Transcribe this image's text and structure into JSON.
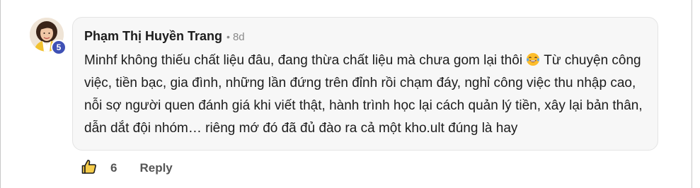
{
  "comment": {
    "author": "Phạm Thị Huyền Trang",
    "separator": "•",
    "time": "8d",
    "badge": "5",
    "text_part1": "Minhf không thiếu chất liệu đâu, đang thừa chất liệu mà chưa gom lại thôi ",
    "emoji_icon": "laughing-tears-emoji",
    "text_part2": " Từ chuyện công việc, tiền bạc, gia đình, những lần đứng trên đỉnh rồi chạm đáy, nghỉ công việc thu nhập cao, nỗi sợ người quen đánh giá khi viết thật, hành trình học lại cách quản lý tiền, xây lại bản thân, dẫn dắt đội nhóm… riêng mớ đó đã đủ đào ra cả một kho.ult đúng là hay",
    "like_icon": "thumbs-up-icon",
    "like_count": "6",
    "reply_label": "Reply"
  },
  "colors": {
    "badge": "#3f51b5",
    "bubble_bg": "#f7f7f7",
    "text": "#1c1c1c",
    "muted": "#8a8a8a",
    "action": "#555555"
  }
}
